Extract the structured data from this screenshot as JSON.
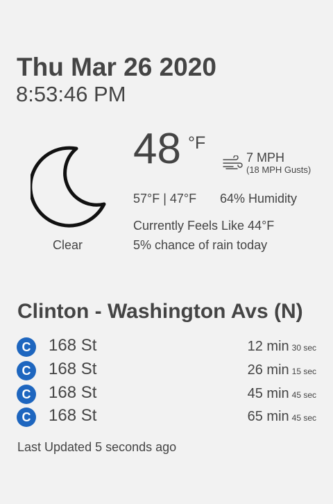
{
  "clock": {
    "date": "Thu Mar 26 2020",
    "time": "8:53:46 PM"
  },
  "weather": {
    "icon": "moon-icon",
    "condition": "Clear",
    "temperature": "48",
    "unit": "°F",
    "wind_icon": "wind-icon",
    "wind": "7 MPH",
    "gusts": "(18 MPH Gusts)",
    "high_low": "57°F | 47°F",
    "humidity": "64% Humidity",
    "feels_like": "Currently Feels Like 44°F",
    "rain_chance": "5% chance of rain today"
  },
  "transit": {
    "station": "Clinton - Washington Avs (N)",
    "line_color": "#1e66bf",
    "arrivals": [
      {
        "line": "C",
        "destination": "168 St",
        "minutes": "12 min",
        "seconds": "30 sec"
      },
      {
        "line": "C",
        "destination": "168 St",
        "minutes": "26 min",
        "seconds": "15 sec"
      },
      {
        "line": "C",
        "destination": "168 St",
        "minutes": "45 min",
        "seconds": "45 sec"
      },
      {
        "line": "C",
        "destination": "168 St",
        "minutes": "65 min",
        "seconds": "45 sec"
      }
    ],
    "last_updated": "Last Updated 5 seconds ago"
  }
}
